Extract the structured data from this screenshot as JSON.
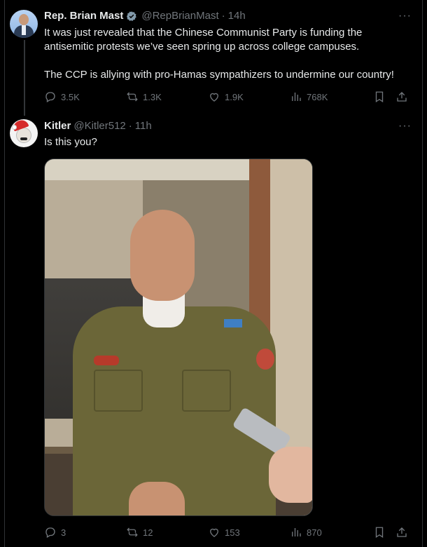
{
  "tweet1": {
    "name": "Rep. Brian Mast",
    "handle": "@RepBrianMast",
    "separator": "·",
    "time": "14h",
    "more": "···",
    "text_p1": "It was just revealed that the Chinese Communist Party is funding the antisemitic protests we’ve seen spring up across college campuses.",
    "text_p2": "The CCP is allying with pro-Hamas sympathizers to undermine our country!",
    "replies": "3.5K",
    "reposts": "1.3K",
    "likes": "1.9K",
    "views": "768K"
  },
  "tweet2": {
    "name": "Kitler",
    "handle": "@Kitler512",
    "separator": "·",
    "time": "11h",
    "more": "···",
    "text": "Is this you?",
    "replies": "3",
    "reposts": "12",
    "likes": "153",
    "views": "870"
  },
  "icons": [
    "reply-icon",
    "repost-icon",
    "like-icon",
    "views-icon",
    "bookmark-icon",
    "share-icon",
    "verified-icon",
    "more-icon"
  ],
  "colors": {
    "background": "#000000",
    "text": "#e7e9ea",
    "muted": "#71767b",
    "verified": "#829aab",
    "border": "#2f3336"
  }
}
